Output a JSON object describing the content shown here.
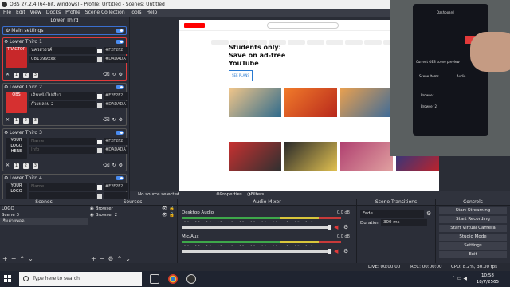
{
  "window": {
    "title": "OBS 27.2.4 (64-bit, windows) - Profile: Untitled - Scenes: Untitled"
  },
  "menu": [
    "File",
    "Edit",
    "View",
    "Docks",
    "Profile",
    "Scene Collection",
    "Tools",
    "Help"
  ],
  "lower_third_dock": {
    "title": "Lower Third",
    "main_settings": "Main settings",
    "items": [
      {
        "title": "Lower Third 1",
        "logo_text": "TRACTOR",
        "line1": "นครสวรรค์",
        "line2": "081399xxx",
        "color1": "#F2F2F2",
        "color2": "#DADADA",
        "color1_hex": "#f2f2f2",
        "color2_hex": "#dadada",
        "active": true,
        "logo_bg": "#c8282a"
      },
      {
        "title": "Lower Third 2",
        "logo_text": "OBS",
        "line1": "เดินหน้าไม่เสียว",
        "line2": "ก๊วยหลาบ 2",
        "color1": "#F2F2F2",
        "color2": "#DADADA",
        "color1_hex": "#f2f2f2",
        "color2_hex": "#dadada",
        "active": false,
        "logo_bg": "#d63030"
      },
      {
        "title": "Lower Third 3",
        "logo_text": "YOUR LOGO HERE",
        "line1": "Name",
        "line2": "Info",
        "color1": "#F2F2F2",
        "color2": "#DADADA",
        "color1_hex": "#f2f2f2",
        "color2_hex": "#dadada",
        "active": false,
        "logo_bg": "#1e2027"
      },
      {
        "title": "Lower Third 4",
        "logo_text": "YOUR LOGO",
        "line1": "Name",
        "line2": "",
        "color1": "#F2F2F2",
        "color2": "",
        "color1_hex": "#f2f2f2",
        "color2_hex": "#dadada",
        "active": false,
        "logo_bg": "#1e2027"
      }
    ],
    "keys": [
      "1",
      "2",
      "3"
    ]
  },
  "preview": {
    "yt_promo": "Students only: Save on ad-free YouTube",
    "yt_promo_button": "SEE PLANS",
    "phone_labels": [
      "Dashboard",
      "Current OBS scene preview",
      "Scene Items",
      "Audio",
      "Browser",
      "Browser 2"
    ]
  },
  "source_bar": {
    "no_source": "No source selected",
    "properties": "Properties",
    "filters": "Filters"
  },
  "scenes": {
    "title": "Scenes",
    "items": [
      "LOGO",
      "Scene 3",
      "เริ่มถ่ายทอด"
    ]
  },
  "sources": {
    "title": "Sources",
    "items": [
      "Browser",
      "Browser 2"
    ]
  },
  "mixer": {
    "title": "Audio Mixer",
    "channels": [
      {
        "name": "Desktop Audio",
        "db": "0.0 dB"
      },
      {
        "name": "Mic/Aux",
        "db": "0.0 dB"
      }
    ],
    "scale": "-60 -55 -50 -45 -40 -35 -30 -25 -20 -15 -10 -5 0"
  },
  "transitions": {
    "title": "Scene Transitions",
    "type": "Fade",
    "duration_label": "Duration",
    "duration": "300 ms"
  },
  "controls": {
    "title": "Controls",
    "buttons": [
      "Start Streaming",
      "Start Recording",
      "Start Virtual Camera",
      "Studio Mode",
      "Settings",
      "Exit"
    ]
  },
  "status": {
    "live": "LIVE: 00:00:00",
    "rec": "REC: 00:00:00",
    "cpu": "CPU: 8.2%, 30.00 fps"
  },
  "taskbar": {
    "search_placeholder": "Type here to search",
    "time": "10:58",
    "date": "18/7/2565"
  }
}
